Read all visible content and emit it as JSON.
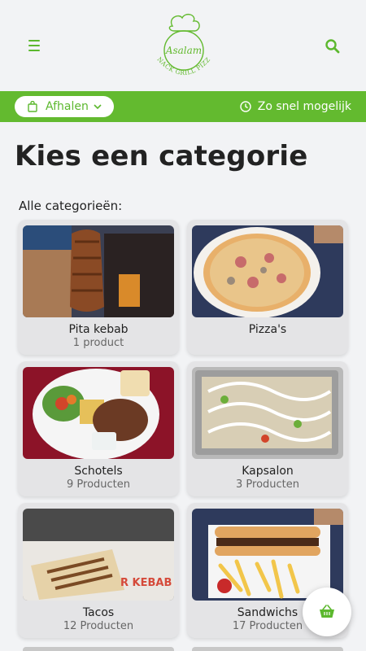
{
  "header": {
    "logo_script": "Asalam",
    "logo_tagline": "SNACK GRILL PIZZA"
  },
  "bar": {
    "pickup_label": "Afhalen",
    "time_label": "Zo snel mogelijk"
  },
  "page": {
    "title": "Kies een categorie",
    "subtitle": "Alle categorieën:"
  },
  "categories": [
    {
      "name": "Pita kebab",
      "count": "1 product"
    },
    {
      "name": "Pizza's",
      "count": ""
    },
    {
      "name": "Schotels",
      "count": "9 Producten"
    },
    {
      "name": "Kapsalon",
      "count": "3 Producten"
    },
    {
      "name": "Tacos",
      "count": "12 Producten"
    },
    {
      "name": "Sandwichs",
      "count": "17 Producten"
    }
  ],
  "colors": {
    "brand_green": "#63ba2f",
    "background": "#f2f3f5",
    "card": "#e4e4e6"
  },
  "icons": [
    "menu-icon",
    "search-icon",
    "bag-icon",
    "chevron-down-icon",
    "clock-icon",
    "basket-icon"
  ]
}
